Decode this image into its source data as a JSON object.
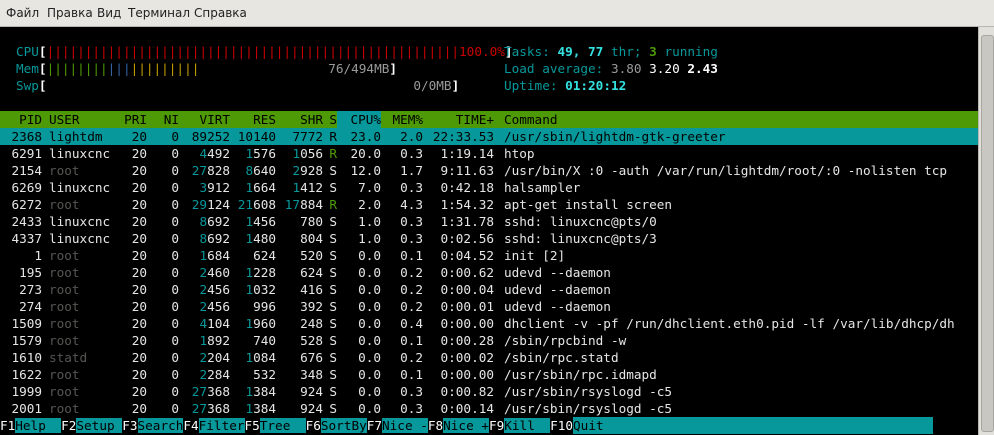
{
  "menu": [
    "Файл",
    "Правка",
    "Вид",
    "Терминал",
    "Справка"
  ],
  "meters": {
    "cpu": {
      "label": "CPU",
      "bar": "||||||||||||||||||||||||||||||||||||||||||||||||||||||",
      "value": "100.0%"
    },
    "mem": {
      "label": "Mem",
      "bar": "||||||||||||||||||||",
      "value": "76/494MB"
    },
    "swp": {
      "label": "Swp",
      "bar": "",
      "value": "0/0MB"
    }
  },
  "stats": {
    "tasks_label": "Tasks:",
    "tasks": "49,",
    "thr": "77",
    "thr_label": "thr;",
    "running": "3",
    "running_label": "running",
    "load_label": "Load average:",
    "load1": "3.80",
    "load5": "3.20",
    "load15": "2.43",
    "uptime_label": "Uptime:",
    "uptime": "01:20:12"
  },
  "columns": [
    "PID",
    "USER",
    "PRI",
    "NI",
    "VIRT",
    "RES",
    "SHR",
    "S",
    "CPU%",
    "MEM%",
    "TIME+",
    "Command"
  ],
  "processes": [
    {
      "pid": "2368",
      "user": "lightdm",
      "pri": "20",
      "ni": "0",
      "virt": "89252",
      "res": "10140",
      "shr": "7772",
      "s": "R",
      "cpu": "23.0",
      "mem": "2.0",
      "time": "22:33.53",
      "cmd": "/usr/sbin/lightdm-gtk-greeter"
    },
    {
      "pid": "6291",
      "user": "linuxcnc",
      "pri": "20",
      "ni": "0",
      "virt": "4492",
      "res": "1576",
      "shr": "1056",
      "s": "R",
      "cpu": "20.0",
      "mem": "0.3",
      "time": "1:19.14",
      "cmd": "htop"
    },
    {
      "pid": "2154",
      "user": "root",
      "pri": "20",
      "ni": "0",
      "virt": "27828",
      "res": "8640",
      "shr": "2928",
      "s": "S",
      "cpu": "12.0",
      "mem": "1.7",
      "time": "9:11.63",
      "cmd": "/usr/bin/X :0 -auth /var/run/lightdm/root/:0 -nolisten tcp"
    },
    {
      "pid": "6269",
      "user": "linuxcnc",
      "pri": "20",
      "ni": "0",
      "virt": "3912",
      "res": "1664",
      "shr": "1412",
      "s": "S",
      "cpu": "7.0",
      "mem": "0.3",
      "time": "0:42.18",
      "cmd": "halsampler"
    },
    {
      "pid": "6272",
      "user": "root",
      "pri": "20",
      "ni": "0",
      "virt": "29124",
      "res": "21608",
      "shr": "17884",
      "s": "R",
      "cpu": "2.0",
      "mem": "4.3",
      "time": "1:54.32",
      "cmd": "apt-get install screen"
    },
    {
      "pid": "2433",
      "user": "linuxcnc",
      "pri": "20",
      "ni": "0",
      "virt": "8692",
      "res": "1456",
      "shr": "780",
      "s": "S",
      "cpu": "1.0",
      "mem": "0.3",
      "time": "1:31.78",
      "cmd": "sshd: linuxcnc@pts/0"
    },
    {
      "pid": "4337",
      "user": "linuxcnc",
      "pri": "20",
      "ni": "0",
      "virt": "8692",
      "res": "1480",
      "shr": "804",
      "s": "S",
      "cpu": "1.0",
      "mem": "0.3",
      "time": "0:02.56",
      "cmd": "sshd: linuxcnc@pts/3"
    },
    {
      "pid": "1",
      "user": "root",
      "pri": "20",
      "ni": "0",
      "virt": "1684",
      "res": "624",
      "shr": "520",
      "s": "S",
      "cpu": "0.0",
      "mem": "0.1",
      "time": "0:04.52",
      "cmd": "init [2]"
    },
    {
      "pid": "195",
      "user": "root",
      "pri": "20",
      "ni": "0",
      "virt": "2460",
      "res": "1228",
      "shr": "624",
      "s": "S",
      "cpu": "0.0",
      "mem": "0.2",
      "time": "0:00.62",
      "cmd": "udevd --daemon"
    },
    {
      "pid": "273",
      "user": "root",
      "pri": "20",
      "ni": "0",
      "virt": "2456",
      "res": "1032",
      "shr": "416",
      "s": "S",
      "cpu": "0.0",
      "mem": "0.2",
      "time": "0:00.04",
      "cmd": "udevd --daemon"
    },
    {
      "pid": "274",
      "user": "root",
      "pri": "20",
      "ni": "0",
      "virt": "2456",
      "res": "996",
      "shr": "392",
      "s": "S",
      "cpu": "0.0",
      "mem": "0.2",
      "time": "0:00.01",
      "cmd": "udevd --daemon"
    },
    {
      "pid": "1509",
      "user": "root",
      "pri": "20",
      "ni": "0",
      "virt": "4104",
      "res": "1960",
      "shr": "248",
      "s": "S",
      "cpu": "0.0",
      "mem": "0.4",
      "time": "0:00.00",
      "cmd": "dhclient -v -pf /run/dhclient.eth0.pid -lf /var/lib/dhcp/dh"
    },
    {
      "pid": "1579",
      "user": "root",
      "pri": "20",
      "ni": "0",
      "virt": "1892",
      "res": "740",
      "shr": "528",
      "s": "S",
      "cpu": "0.0",
      "mem": "0.1",
      "time": "0:00.28",
      "cmd": "/sbin/rpcbind -w"
    },
    {
      "pid": "1610",
      "user": "statd",
      "pri": "20",
      "ni": "0",
      "virt": "2204",
      "res": "1084",
      "shr": "676",
      "s": "S",
      "cpu": "0.0",
      "mem": "0.2",
      "time": "0:00.02",
      "cmd": "/sbin/rpc.statd"
    },
    {
      "pid": "1622",
      "user": "root",
      "pri": "20",
      "ni": "0",
      "virt": "2284",
      "res": "532",
      "shr": "348",
      "s": "S",
      "cpu": "0.0",
      "mem": "0.1",
      "time": "0:00.00",
      "cmd": "/usr/sbin/rpc.idmapd"
    },
    {
      "pid": "1999",
      "user": "root",
      "pri": "20",
      "ni": "0",
      "virt": "27368",
      "res": "1384",
      "shr": "924",
      "s": "S",
      "cpu": "0.0",
      "mem": "0.3",
      "time": "0:00.82",
      "cmd": "/usr/sbin/rsyslogd -c5"
    },
    {
      "pid": "2001",
      "user": "root",
      "pri": "20",
      "ni": "0",
      "virt": "27368",
      "res": "1384",
      "shr": "924",
      "s": "S",
      "cpu": "0.0",
      "mem": "0.3",
      "time": "0:00.14",
      "cmd": "/usr/sbin/rsyslogd -c5"
    }
  ],
  "fkeys": [
    {
      "key": "F1",
      "label": "Help  "
    },
    {
      "key": "F2",
      "label": "Setup "
    },
    {
      "key": "F3",
      "label": "Search"
    },
    {
      "key": "F4",
      "label": "Filter"
    },
    {
      "key": "F5",
      "label": "Tree  "
    },
    {
      "key": "F6",
      "label": "SortBy"
    },
    {
      "key": "F7",
      "label": "Nice -"
    },
    {
      "key": "F8",
      "label": "Nice +"
    },
    {
      "key": "F9",
      "label": "Kill  "
    },
    {
      "key": "F10",
      "label": "Quit"
    }
  ]
}
